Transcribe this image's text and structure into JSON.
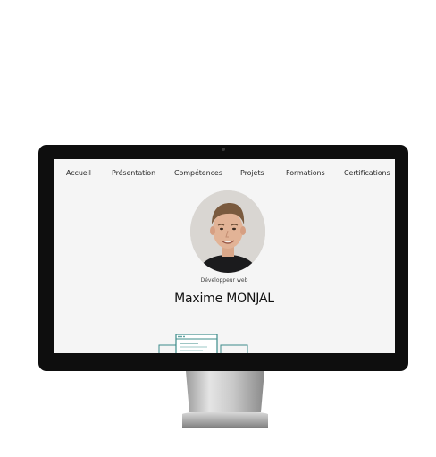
{
  "nav": {
    "items": [
      {
        "label": "Accueil"
      },
      {
        "label": "Présentation"
      },
      {
        "label": "Compétences"
      },
      {
        "label": "Projets"
      },
      {
        "label": "Formations"
      },
      {
        "label": "Certifications"
      }
    ]
  },
  "profile": {
    "role": "Développeur web",
    "name": "Maxime MONJAL"
  },
  "colors": {
    "screen_bg": "#f5f5f5",
    "bezel": "#0e0e0e",
    "illustration_accent": "#3d8c8a"
  }
}
